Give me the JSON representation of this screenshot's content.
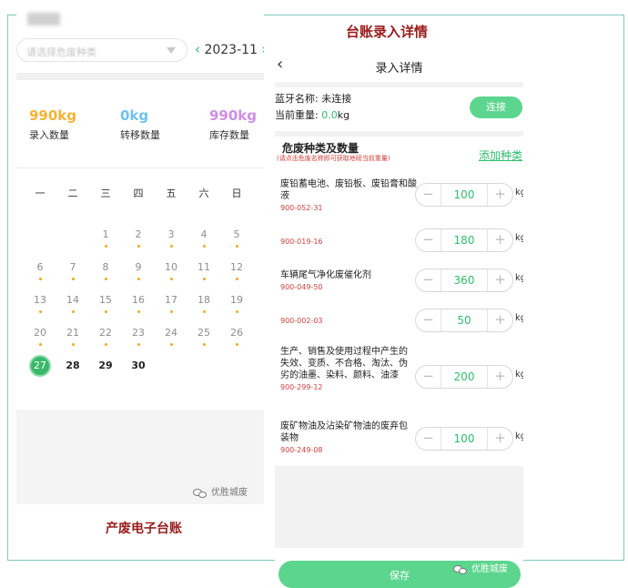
{
  "left": {
    "category_placeholder": "请选择危废种类",
    "month": "2023-11",
    "stats": [
      {
        "value": "990kg",
        "label": "录入数量",
        "color": "#f5b335"
      },
      {
        "value": "0kg",
        "label": "转移数量",
        "color": "#6fc3f0"
      },
      {
        "value": "990kg",
        "label": "库存数量",
        "color": "#cf8fe6"
      }
    ],
    "weekdays": [
      "一",
      "二",
      "三",
      "四",
      "五",
      "六",
      "日"
    ],
    "days": [
      "1",
      "2",
      "3",
      "4",
      "5",
      "6",
      "7",
      "8",
      "9",
      "10",
      "11",
      "12",
      "13",
      "14",
      "15",
      "16",
      "17",
      "18",
      "19",
      "20",
      "21",
      "22",
      "23",
      "24",
      "25",
      "26",
      "27",
      "28",
      "29",
      "30"
    ],
    "today": "27",
    "watermark": "优胜城废",
    "caption": "产废电子台账"
  },
  "right": {
    "caption": "台账录入详情",
    "header_title": "录入详情",
    "bluetooth_label": "蓝牙名称: 未连接",
    "weight_label": "当前重量: ",
    "weight_value": "0.0",
    "weight_unit": "kg",
    "connect_label": "连接",
    "section_title": "危废种类及数量",
    "section_hint": "(请点击危废名称即可获取地磅当前重量)",
    "add_type_label": "添加种类",
    "unit": "kg",
    "items": [
      {
        "name": "废铅蓄电池、废铅板、废铅膏和酸液",
        "code": "900-052-31",
        "qty": "100"
      },
      {
        "name": "",
        "code": "900-019-16",
        "qty": "180"
      },
      {
        "name": "车辆尾气净化废催化剂",
        "code": "900-049-50",
        "qty": "360"
      },
      {
        "name": "",
        "code": "900-002-03",
        "qty": "50"
      },
      {
        "name": "生产、销售及使用过程中产生的失效、变质、不合格、淘汰、伪劣的油墨、染料、颜料、油漆",
        "code": "900-299-12",
        "qty": "200"
      },
      {
        "name": "废矿物油及沾染矿物油的废弃包装物",
        "code": "900-249-08",
        "qty": "100"
      }
    ],
    "save_label": "保存",
    "watermark": "优胜城废"
  },
  "colors": {
    "accent_green": "#2dbf6c",
    "button_green": "#5cd68e",
    "caption_red": "#9b1c1c",
    "code_red": "#d0403c",
    "dot_orange": "#f5a623"
  }
}
